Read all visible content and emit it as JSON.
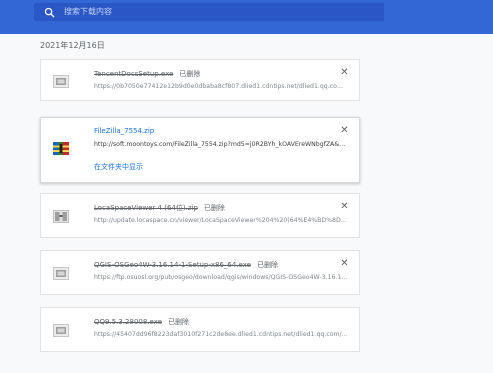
{
  "search": {
    "placeholder": "搜索下载内容"
  },
  "date_header": "2021年12月16日",
  "downloads": [
    {
      "filename": "TencentDocsSetup.exe",
      "status": "已删除",
      "url": "https://0b7050e77412e12b9d0e0dbaba8cf807.dlied1.cdntips.net/dlied1.qq.com/qq...",
      "deleted": true
    },
    {
      "filename": "FileZilla_7554.zip",
      "status": "",
      "url": "http://soft.moontoys.com/FileZilla_7554.zip?md5=j0R2BYh_kOAVEreWNbgfZA&expir...",
      "deleted": false,
      "action": "在文件夹中显示"
    },
    {
      "filename": "LocaSpaceViewer 4 (64位).zip",
      "status": "已删除",
      "url": "http://update.locaspace.cn/viewer/LocaSpaceViewer%204%20(64%E4%BD%8D).zip?...",
      "deleted": true
    },
    {
      "filename": "QGIS-OSGeo4W-3.16.14-1-Setup-x86_64.exe",
      "status": "已删除",
      "url": "https://ftp.osuosl.org/pub/osgeo/download/qgis/windows/QGIS-OSGeo4W-3.16.14-...",
      "deleted": true
    },
    {
      "filename": "QQ9.5.3.28008.exe",
      "status": "已删除",
      "url": "https://45407dd96f8223daf3010f271c2de8ee.dlied1.cdntips.net/dlied1.qq.com/qqw...",
      "deleted": true
    }
  ],
  "icons": {
    "search": "search-icon",
    "close": "close-icon",
    "file": "file-icon",
    "archive": "archive-icon"
  },
  "colors": {
    "header": "#3367d6",
    "link": "#1a73e8"
  }
}
